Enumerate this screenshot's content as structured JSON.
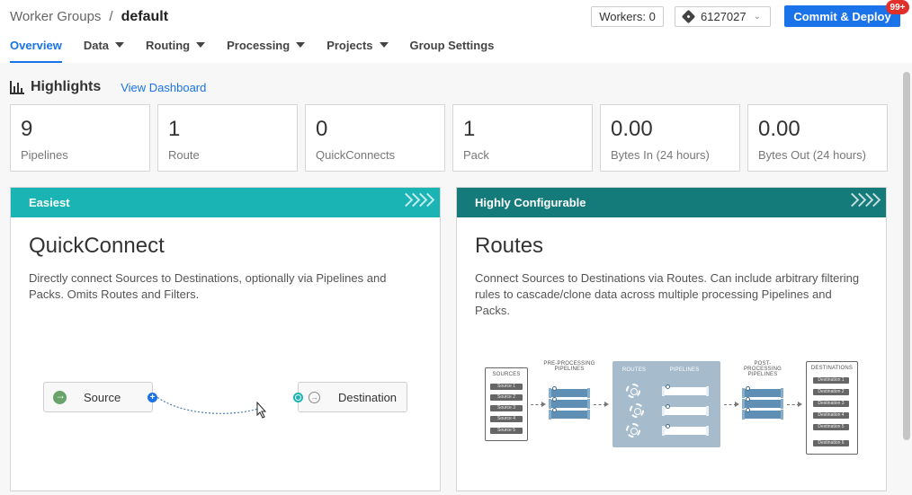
{
  "breadcrumb": {
    "parent": "Worker Groups",
    "separator": "/",
    "current": "default"
  },
  "header": {
    "workers_label": "Workers: 0",
    "commit_id": "6127027",
    "deploy_label": "Commit & Deploy",
    "notification_badge": "99+"
  },
  "tabs": [
    {
      "label": "Overview",
      "active": true,
      "dropdown": false
    },
    {
      "label": "Data",
      "active": false,
      "dropdown": true
    },
    {
      "label": "Routing",
      "active": false,
      "dropdown": true
    },
    {
      "label": "Processing",
      "active": false,
      "dropdown": true
    },
    {
      "label": "Projects",
      "active": false,
      "dropdown": true
    },
    {
      "label": "Group Settings",
      "active": false,
      "dropdown": false
    }
  ],
  "highlights": {
    "title": "Highlights",
    "dashboard_link": "View Dashboard",
    "stats": [
      {
        "value": "9",
        "label": "Pipelines"
      },
      {
        "value": "1",
        "label": "Route"
      },
      {
        "value": "0",
        "label": "QuickConnects"
      },
      {
        "value": "1",
        "label": "Pack"
      },
      {
        "value": "0.00",
        "label": "Bytes In (24 hours)"
      },
      {
        "value": "0.00",
        "label": "Bytes Out (24 hours)"
      }
    ]
  },
  "cards": {
    "quickconnect": {
      "tag": "Easiest",
      "title": "QuickConnect",
      "description": "Directly connect Sources to Destinations, optionally via Pipelines and Packs. Omits Routes and Filters.",
      "source_label": "Source",
      "destination_label": "Destination"
    },
    "routes": {
      "tag": "Highly Configurable",
      "title": "Routes",
      "description": "Connect Sources to Destinations via Routes. Can include arbitrary filtering rules to cascade/clone data across multiple processing Pipelines and Packs.",
      "diagram": {
        "sources_label": "SOURCES",
        "sources": [
          "Source 1",
          "Source 2",
          "Source 3",
          "Source 4",
          "Source 5"
        ],
        "pre_label": "PRE-PROCESSING PIPELINES",
        "routes_label": "ROUTES",
        "pipelines_label": "PIPELINES",
        "post_label": "POST-PROCESSING PIPELINES",
        "destinations_label": "DESTINATIONS",
        "destinations": [
          "Destination 1",
          "Destination 2",
          "Destination 3",
          "Destination 4",
          "Destination 5",
          "Destination 6"
        ]
      }
    }
  },
  "colors": {
    "accent": "#1a73e8",
    "easiest_header": "#1ab4b4",
    "configurable_header": "#147a7a",
    "badge": "#e0302a"
  }
}
